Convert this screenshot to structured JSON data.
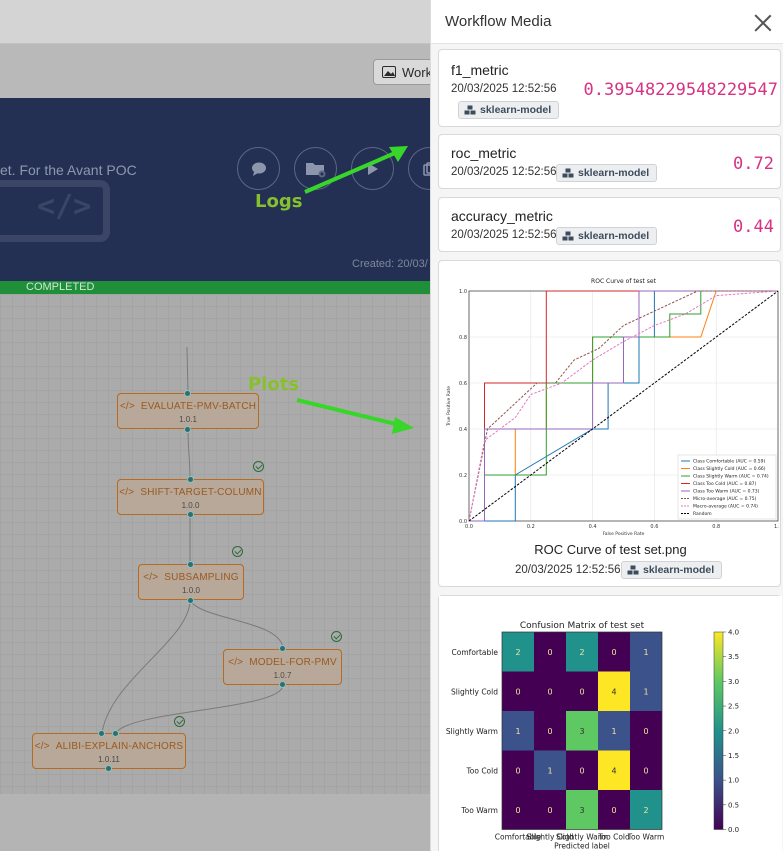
{
  "background": {
    "media_button_label": "Work",
    "banner_description": "et. For the Avant POC",
    "created_text": "Created: 20/03/",
    "status_label": "COMPLETED",
    "annotations": {
      "logs": "Logs",
      "plots": "Plots"
    },
    "nodes": [
      {
        "name": "EVALUATE-PMV-BATCH",
        "version": "1.0.1"
      },
      {
        "name": "SHIFT-TARGET-COLUMN",
        "version": "1.0.0"
      },
      {
        "name": "SUBSAMPLING",
        "version": "1.0.0"
      },
      {
        "name": "MODEL-FOR-PMV",
        "version": "1.0.7"
      },
      {
        "name": "ALIBI-EXPLAIN-ANCHORS",
        "version": "1.0.11"
      }
    ]
  },
  "panel": {
    "title": "Workflow Media",
    "tag_label": "sklearn-model",
    "metrics": [
      {
        "name": "f1_metric",
        "date": "20/03/2025 12:52:56",
        "value": "0.39548229548229547"
      },
      {
        "name": "roc_metric",
        "date": "20/03/2025 12:52:56",
        "value": "0.72"
      },
      {
        "name": "accuracy_metric",
        "date": "20/03/2025 12:52:56",
        "value": "0.44"
      }
    ],
    "roc_card": {
      "caption": "ROC Curve of test set.png",
      "date": "20/03/2025 12:52:56"
    }
  },
  "colors": {
    "accent_pink": "#d63384",
    "arrow_green": "#38d62a",
    "annotation_green": "#86c12d",
    "banner": "#243053",
    "status_green": "#1f8f3a"
  },
  "chart_data": [
    {
      "type": "line",
      "title": "ROC Curve of test set",
      "xlabel": "False Positive Rate",
      "ylabel": "True Positive Rate",
      "xlim": [
        0,
        1
      ],
      "ylim": [
        0,
        1
      ],
      "xticks": [
        "0.0",
        "0.2",
        "0.4",
        "0.6",
        "0.8",
        "1.0"
      ],
      "yticks": [
        "0.0",
        "0.2",
        "0.4",
        "0.6",
        "0.8",
        "1.0"
      ],
      "grid": true,
      "legend_position": "lower-right",
      "series": [
        {
          "name": "Class Comfortable (AUC = 0.59)",
          "color": "#1f77b4",
          "style": "solid",
          "x": [
            0,
            0.15,
            0.15,
            0.4,
            0.45,
            0.45,
            0.55,
            0.55,
            0.6,
            0.6,
            0.75,
            0.75,
            1.0
          ],
          "y": [
            0,
            0,
            0.2,
            0.4,
            0.4,
            0.6,
            0.6,
            0.8,
            0.8,
            1.0,
            1.0,
            1.0,
            1.0
          ]
        },
        {
          "name": "Class Slightly Cold (AUC = 0.66)",
          "color": "#ff7f0e",
          "style": "solid",
          "x": [
            0,
            0.05,
            0.05,
            0.15,
            0.15,
            0.25,
            0.25,
            0.4,
            0.4,
            0.75,
            0.8,
            0.8,
            1.0
          ],
          "y": [
            0,
            0,
            0.2,
            0.2,
            0.4,
            0.4,
            0.6,
            0.6,
            0.8,
            0.8,
            1.0,
            1.0,
            1.0
          ]
        },
        {
          "name": "Class Slightly Warm (AUC = 0.74)",
          "color": "#2ca02c",
          "style": "solid",
          "x": [
            0,
            0.05,
            0.05,
            0.25,
            0.25,
            0.4,
            0.4,
            0.65,
            0.65,
            0.75,
            0.75,
            1.0
          ],
          "y": [
            0,
            0,
            0.2,
            0.2,
            0.6,
            0.6,
            0.8,
            0.8,
            0.9,
            0.9,
            1.0,
            1.0
          ]
        },
        {
          "name": "Class Too Cold (AUC = 0.87)",
          "color": "#d62728",
          "style": "solid",
          "x": [
            0,
            0.05,
            0.05,
            0.25,
            0.25,
            1.0
          ],
          "y": [
            0,
            0,
            0.6,
            0.6,
            1.0,
            1.0
          ]
        },
        {
          "name": "Class Too Warm (AUC = 0.73)",
          "color": "#9467bd",
          "style": "solid",
          "x": [
            0,
            0.05,
            0.05,
            0.4,
            0.4,
            0.5,
            0.5,
            0.55,
            0.55,
            0.65,
            0.65,
            1.0
          ],
          "y": [
            0,
            0,
            0.4,
            0.4,
            0.6,
            0.6,
            0.8,
            0.8,
            1.0,
            1.0,
            1.0,
            1.0
          ]
        },
        {
          "name": "Micro-average (AUC = 0.75)",
          "color": "#8c564b",
          "style": "dashed",
          "x": [
            0,
            0.03,
            0.06,
            0.1,
            0.14,
            0.18,
            0.22,
            0.28,
            0.34,
            0.42,
            0.5,
            0.58,
            0.66,
            0.74,
            0.82,
            1.0
          ],
          "y": [
            0,
            0.2,
            0.4,
            0.45,
            0.5,
            0.55,
            0.6,
            0.6,
            0.7,
            0.75,
            0.85,
            0.9,
            0.95,
            1.0,
            1.0,
            1.0
          ]
        },
        {
          "name": "Macro-average (AUC = 0.74)",
          "color": "#e377c2",
          "style": "dashed",
          "x": [
            0,
            0.05,
            0.1,
            0.15,
            0.2,
            0.3,
            0.4,
            0.5,
            0.6,
            0.7,
            0.8,
            1.0
          ],
          "y": [
            0,
            0.35,
            0.4,
            0.45,
            0.55,
            0.6,
            0.7,
            0.78,
            0.85,
            0.9,
            0.98,
            1.0
          ]
        },
        {
          "name": "Random",
          "color": "#000000",
          "style": "dashed",
          "x": [
            0,
            1
          ],
          "y": [
            0,
            1
          ]
        }
      ]
    },
    {
      "type": "heatmap",
      "title": "Confusion Matrix of test set",
      "xlabel": "Predicted label",
      "row_labels": [
        "Comfortable",
        "Slightly Cold",
        "Slightly Warm",
        "Too Cold",
        "Too Warm"
      ],
      "col_labels": [
        "Comfortable",
        "Slightly Cold",
        "Slightly Warm",
        "Too Cold",
        "Too Warm"
      ],
      "values": [
        [
          2,
          0,
          2,
          0,
          1
        ],
        [
          0,
          0,
          0,
          4,
          1
        ],
        [
          1,
          0,
          3,
          1,
          0
        ],
        [
          0,
          1,
          0,
          4,
          0
        ],
        [
          0,
          0,
          3,
          0,
          2
        ]
      ],
      "colorbar_range": [
        0,
        4
      ],
      "colorbar_ticks": [
        "0.0",
        "0.5",
        "1.0",
        "1.5",
        "2.0",
        "2.5",
        "3.0",
        "3.5",
        "4.0"
      ]
    }
  ]
}
